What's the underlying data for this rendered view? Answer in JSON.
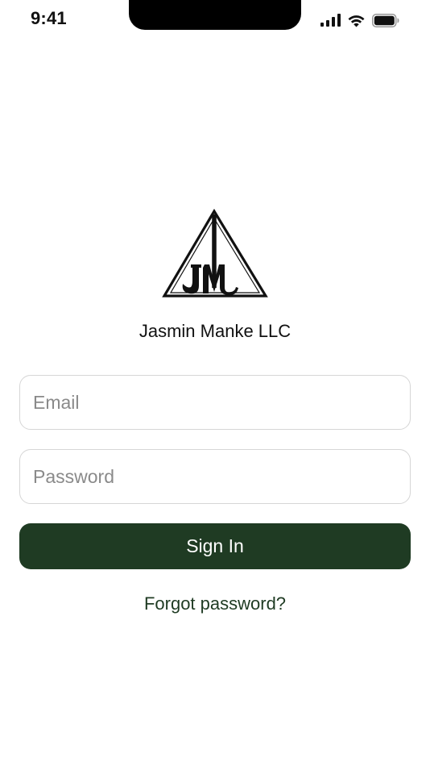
{
  "status_bar": {
    "time": "9:41",
    "icons": [
      "cellular-signal-icon",
      "wifi-icon",
      "battery-icon"
    ]
  },
  "brand": {
    "logo": "company-logo",
    "logo_monogram": "JM",
    "company_name": "Jasmin Manke LLC"
  },
  "form": {
    "email": {
      "value": "",
      "placeholder": "Email"
    },
    "password": {
      "value": "",
      "placeholder": "Password"
    },
    "sign_in_label": "Sign In",
    "forgot_password_label": "Forgot password?"
  },
  "colors": {
    "primary": "#1f3b23",
    "background": "#ffffff",
    "field_border": "#d6d6d6",
    "placeholder": "#8a8a8a"
  }
}
